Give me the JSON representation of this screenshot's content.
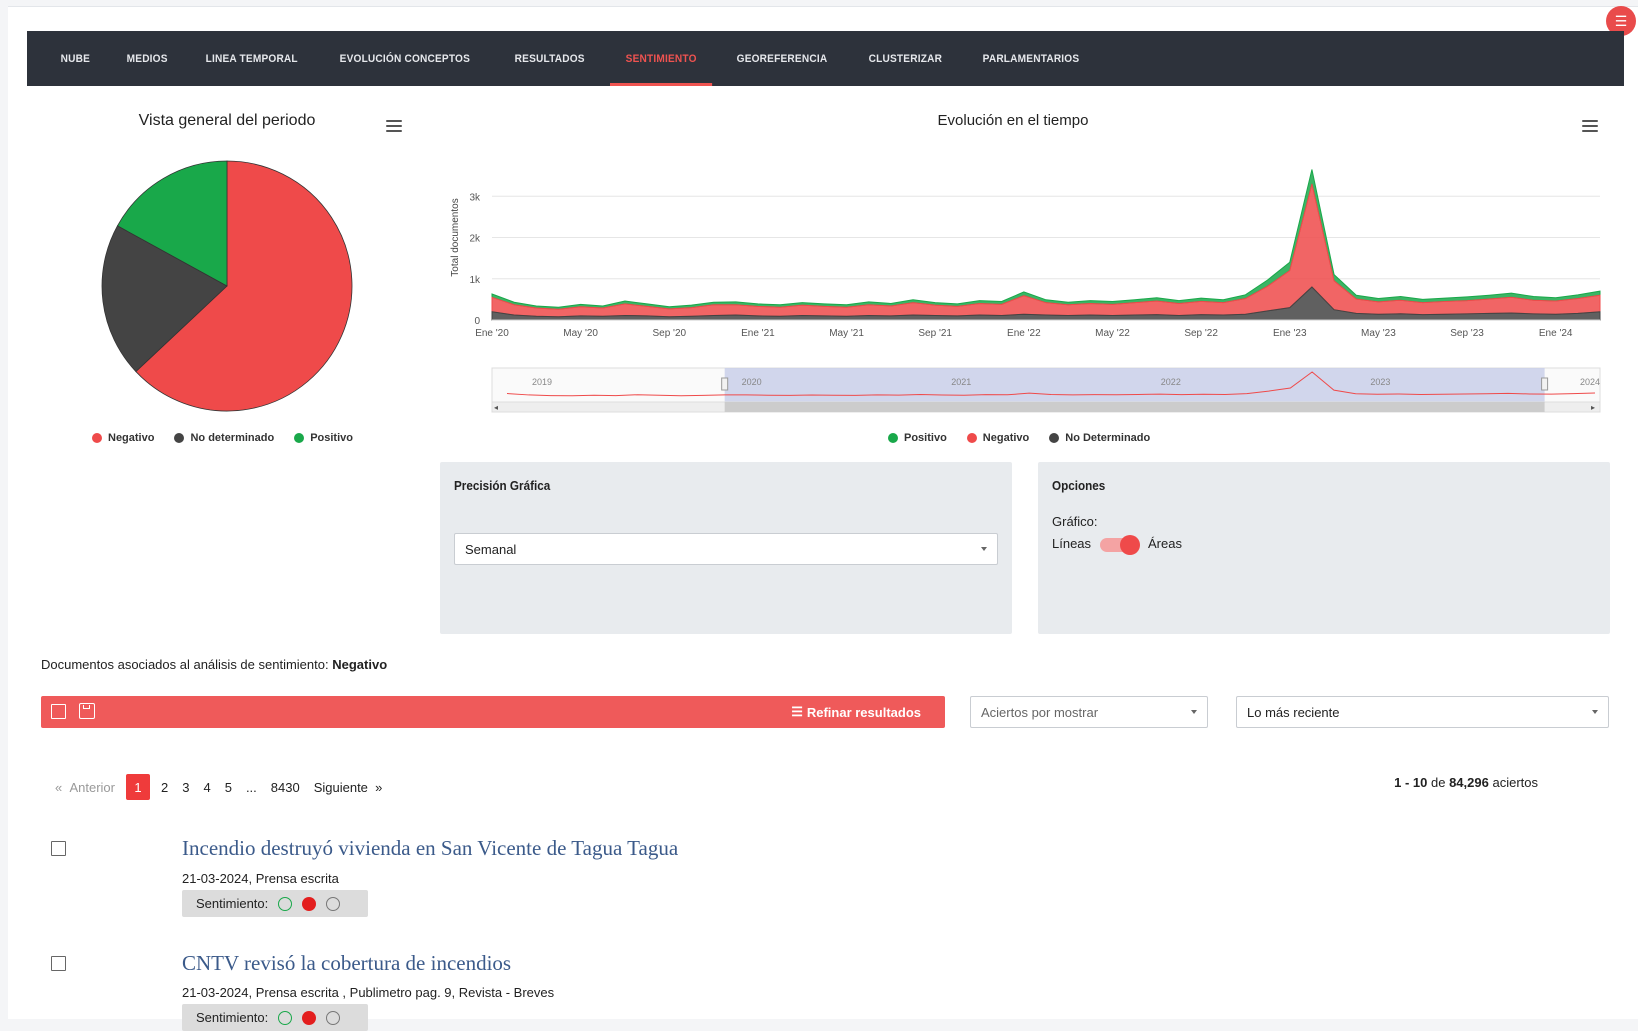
{
  "nav": {
    "items": [
      "NUBE",
      "MEDIOS",
      "LINEA TEMPORAL",
      "EVOLUCIÓN CONCEPTOS",
      "RESULTADOS",
      "SENTIMIENTO",
      "GEOREFERENCIA",
      "CLUSTERIZAR",
      "PARLAMENTARIOS"
    ],
    "active": "SENTIMIENTO"
  },
  "colors": {
    "negativo": "#ef4a4a",
    "no_determinado": "#444444",
    "positivo": "#19a84a",
    "nav_bg": "#2d323b",
    "accent": "#ef5350"
  },
  "pie": {
    "title": "Vista general del periodo",
    "legend": [
      "Negativo",
      "No determinado",
      "Positivo"
    ]
  },
  "line": {
    "title": "Evolución en el tiempo",
    "legend": [
      "Positivo",
      "Negativo",
      "No Determinado"
    ]
  },
  "chart_data": [
    {
      "type": "pie",
      "title": "Vista general del periodo",
      "series": [
        {
          "name": "Negativo",
          "value": 63,
          "color": "#ef4a4a"
        },
        {
          "name": "No determinado",
          "value": 20,
          "color": "#444444"
        },
        {
          "name": "Positivo",
          "value": 17,
          "color": "#19a84a"
        }
      ],
      "legend": "bottom"
    },
    {
      "type": "area",
      "title": "Evolución en el tiempo",
      "ylabel": "Total documentos",
      "ylim": [
        0,
        4000
      ],
      "yticks": [
        "0",
        "1k",
        "2k",
        "3k"
      ],
      "ytick_values": [
        0,
        1000,
        2000,
        3000
      ],
      "xticks": [
        "Ene '20",
        "May '20",
        "Sep '20",
        "Ene '21",
        "May '21",
        "Sep '21",
        "Ene '22",
        "May '22",
        "Sep '22",
        "Ene '23",
        "May '23",
        "Sep '23",
        "Ene '24"
      ],
      "xlim": [
        "2020-01",
        "2024-03"
      ],
      "x": [
        "2020-01",
        "2020-02",
        "2020-03",
        "2020-04",
        "2020-05",
        "2020-06",
        "2020-07",
        "2020-08",
        "2020-09",
        "2020-10",
        "2020-11",
        "2020-12",
        "2021-01",
        "2021-02",
        "2021-03",
        "2021-04",
        "2021-05",
        "2021-06",
        "2021-07",
        "2021-08",
        "2021-09",
        "2021-10",
        "2021-11",
        "2021-12",
        "2022-01",
        "2022-02",
        "2022-03",
        "2022-04",
        "2022-05",
        "2022-06",
        "2022-07",
        "2022-08",
        "2022-09",
        "2022-10",
        "2022-11",
        "2022-12",
        "2023-01",
        "2023-02",
        "2023-03",
        "2023-04",
        "2023-05",
        "2023-06",
        "2023-07",
        "2023-08",
        "2023-09",
        "2023-10",
        "2023-11",
        "2023-12",
        "2024-01",
        "2024-02",
        "2024-03"
      ],
      "series": [
        {
          "name": "No Determinado",
          "color": "#444444",
          "values": [
            200,
            120,
            90,
            80,
            100,
            90,
            110,
            100,
            80,
            90,
            110,
            120,
            100,
            90,
            110,
            100,
            90,
            110,
            100,
            120,
            110,
            100,
            120,
            110,
            140,
            120,
            110,
            120,
            110,
            120,
            130,
            110,
            130,
            120,
            140,
            220,
            300,
            800,
            250,
            160,
            140,
            150,
            130,
            140,
            150,
            160,
            170,
            150,
            140,
            160,
            200
          ]
        },
        {
          "name": "Negativo",
          "color": "#ef4a4a",
          "values": [
            350,
            250,
            200,
            180,
            220,
            200,
            280,
            230,
            190,
            210,
            260,
            250,
            230,
            220,
            250,
            230,
            220,
            260,
            240,
            300,
            250,
            230,
            280,
            270,
            450,
            300,
            260,
            280,
            270,
            300,
            330,
            290,
            320,
            300,
            380,
            600,
            900,
            2500,
            700,
            350,
            300,
            330,
            290,
            310,
            320,
            350,
            380,
            330,
            320,
            360,
            400
          ]
        },
        {
          "name": "Positivo",
          "color": "#19a84a",
          "values": [
            80,
            60,
            50,
            50,
            60,
            50,
            70,
            60,
            50,
            60,
            60,
            70,
            60,
            60,
            60,
            60,
            60,
            70,
            60,
            70,
            60,
            60,
            70,
            70,
            90,
            70,
            60,
            70,
            70,
            70,
            80,
            70,
            80,
            70,
            90,
            150,
            200,
            350,
            150,
            90,
            80,
            90,
            80,
            80,
            90,
            90,
            100,
            90,
            80,
            90,
            100
          ]
        }
      ],
      "navigator_labels": [
        "2019",
        "2020",
        "2021",
        "2022",
        "2023",
        "2024"
      ],
      "legend": "bottom"
    }
  ],
  "precision": {
    "title": "Precisión Gráfica",
    "selected": "Semanal"
  },
  "options": {
    "title": "Opciones",
    "grafico_label": "Gráfico:",
    "left_label": "Líneas",
    "right_label": "Áreas",
    "toggle_state": "Áreas"
  },
  "docs": {
    "caption_prefix": "Documentos asociados al análisis de sentimiento:",
    "caption_value": "Negativo",
    "refine_label": "Refinar resultados",
    "per_page_placeholder": "Aciertos por mostrar",
    "sort_selected": "Lo más reciente",
    "pager": {
      "prev": "Anterior",
      "pages": [
        "1",
        "2",
        "3",
        "4",
        "5",
        "...",
        "8430"
      ],
      "current": "1",
      "next": "Siguiente"
    },
    "hits": {
      "range": "1 - 10",
      "de": "de",
      "total": "84,296",
      "suffix": "aciertos"
    },
    "results": [
      {
        "title": "Incendio destruyó vivienda en San Vicente de Tagua Tagua",
        "meta": "21-03-2024, Prensa escrita",
        "sentiment_label": "Sentimiento:",
        "sentiment": "Negativo"
      },
      {
        "title": "CNTV revisó la cobertura de incendios",
        "meta": "21-03-2024, Prensa escrita , Publimetro pag. 9, Revista - Breves",
        "sentiment_label": "Sentimiento:",
        "sentiment": "Negativo"
      }
    ]
  }
}
